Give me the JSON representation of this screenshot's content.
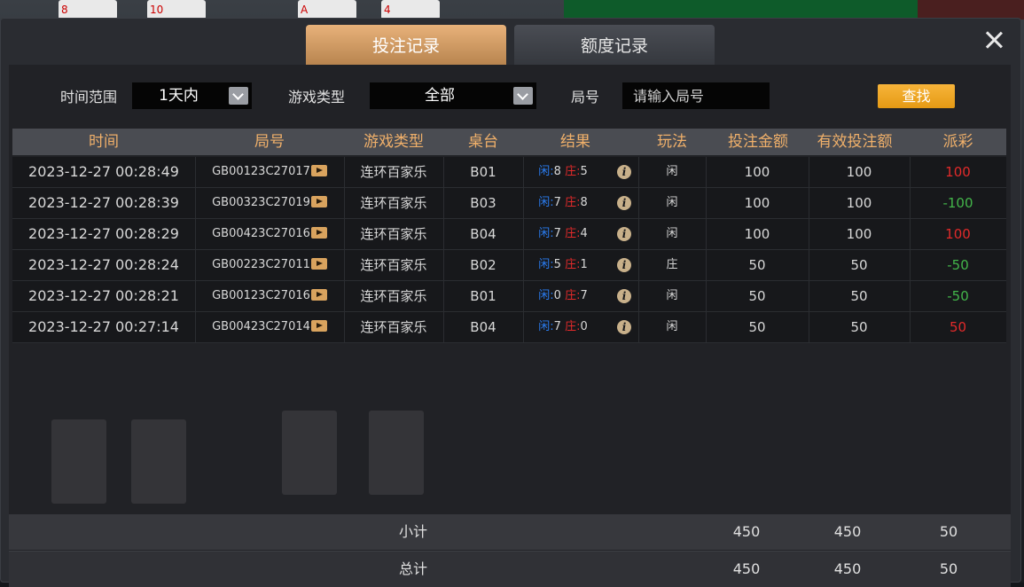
{
  "background": {
    "cards": [
      "8",
      "10",
      "A",
      "4"
    ]
  },
  "tabs": {
    "active": "投注记录",
    "inactive": "额度记录"
  },
  "filters": {
    "time_range_label": "时间范围",
    "time_range_value": "1天内",
    "game_type_label": "游戏类型",
    "game_type_value": "全部",
    "round_label": "局号",
    "round_placeholder": "请输入局号",
    "search_label": "查找"
  },
  "table": {
    "headers": [
      "时间",
      "局号",
      "游戏类型",
      "桌台",
      "结果",
      "玩法",
      "投注金额",
      "有效投注额",
      "派彩"
    ],
    "rows": [
      {
        "time": "2023-12-27 00:28:49",
        "round": "GB00123C27017",
        "game": "连环百家乐",
        "table": "B01",
        "player_label": "闲:",
        "player": "8",
        "banker_label": "庄:",
        "banker": "5",
        "play": "闲",
        "bet": "100",
        "valid": "100",
        "payout": "100",
        "payout_color": "red"
      },
      {
        "time": "2023-12-27 00:28:39",
        "round": "GB00323C27019",
        "game": "连环百家乐",
        "table": "B03",
        "player_label": "闲:",
        "player": "7",
        "banker_label": "庄:",
        "banker": "8",
        "play": "闲",
        "bet": "100",
        "valid": "100",
        "payout": "-100",
        "payout_color": "green"
      },
      {
        "time": "2023-12-27 00:28:29",
        "round": "GB00423C27016",
        "game": "连环百家乐",
        "table": "B04",
        "player_label": "闲:",
        "player": "7",
        "banker_label": "庄:",
        "banker": "4",
        "play": "闲",
        "bet": "100",
        "valid": "100",
        "payout": "100",
        "payout_color": "red"
      },
      {
        "time": "2023-12-27 00:28:24",
        "round": "GB00223C27011",
        "game": "连环百家乐",
        "table": "B02",
        "player_label": "闲:",
        "player": "5",
        "banker_label": "庄:",
        "banker": "1",
        "play": "庄",
        "bet": "50",
        "valid": "50",
        "payout": "-50",
        "payout_color": "green"
      },
      {
        "time": "2023-12-27 00:28:21",
        "round": "GB00123C27016",
        "game": "连环百家乐",
        "table": "B01",
        "player_label": "闲:",
        "player": "0",
        "banker_label": "庄:",
        "banker": "7",
        "play": "闲",
        "bet": "50",
        "valid": "50",
        "payout": "-50",
        "payout_color": "green"
      },
      {
        "time": "2023-12-27 00:27:14",
        "round": "GB00423C27014",
        "game": "连环百家乐",
        "table": "B04",
        "player_label": "闲:",
        "player": "7",
        "banker_label": "庄:",
        "banker": "0",
        "play": "闲",
        "bet": "50",
        "valid": "50",
        "payout": "50",
        "payout_color": "red"
      }
    ]
  },
  "subtotal": {
    "label": "小计",
    "bet": "450",
    "valid": "450",
    "payout": "50"
  },
  "total": {
    "label": "总计",
    "bet": "450",
    "valid": "450",
    "payout": "50"
  },
  "colors": {
    "accent": "#f0b06a",
    "win": "#e22a2a",
    "loss": "#43b54a",
    "player": "#2a7cf0"
  },
  "icons": [
    "close-icon",
    "chevron-down-icon",
    "play-icon",
    "info-icon"
  ]
}
